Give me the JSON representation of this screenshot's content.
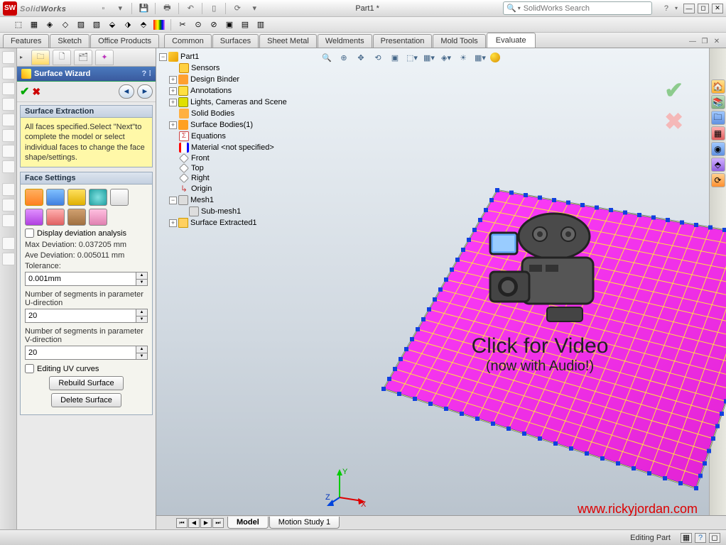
{
  "app": {
    "name_prefix": "Solid",
    "name_suffix": "Works",
    "doc": "Part1 *",
    "search_placeholder": "SolidWorks Search"
  },
  "cmd_tabs": [
    "Features",
    "Sketch",
    "Office Products",
    "Common",
    "Surfaces",
    "Sheet Metal",
    "Weldments",
    "Presentation",
    "Mold Tools",
    "Evaluate"
  ],
  "pm": {
    "title": "Surface Wizard",
    "sec_extract_title": "Surface Extraction",
    "sec_extract_body": "All faces specified.Select \"Next\"to complete the model or select individual faces to change the face shape/settings.",
    "sec_face_title": "Face Settings",
    "chk_deviation": "Display deviation analysis",
    "max_dev": "Max Deviation: 0.037205  mm",
    "ave_dev": "Ave Deviation: 0.005011  mm",
    "lbl_tol": "Tolerance:",
    "val_tol": "0.001mm",
    "lbl_u": "Number of segments in parameter U-direction",
    "val_u": "20",
    "lbl_v": "Number of segments in parameter V-direction",
    "val_v": "20",
    "chk_uv": "Editing UV curves",
    "btn_rebuild": "Rebuild Surface",
    "btn_delete": "Delete Surface"
  },
  "tree": {
    "root": "Part1",
    "items": [
      "Sensors",
      "Design Binder",
      "Annotations",
      "Lights, Cameras and Scene",
      "Solid Bodies",
      "Surface Bodies(1)",
      "Equations",
      "Material <not specified>",
      "Front",
      "Top",
      "Right",
      "Origin",
      "Mesh1",
      "Sub-mesh1",
      "Surface Extracted1"
    ]
  },
  "overlay": {
    "line1": "Click for Video",
    "line2": "(now with Audio!)"
  },
  "watermark": "www.rickyjordan.com",
  "bottom_tabs": {
    "model": "Model",
    "motion": "Motion Study 1"
  },
  "statusbar": {
    "mode": "Editing Part"
  }
}
